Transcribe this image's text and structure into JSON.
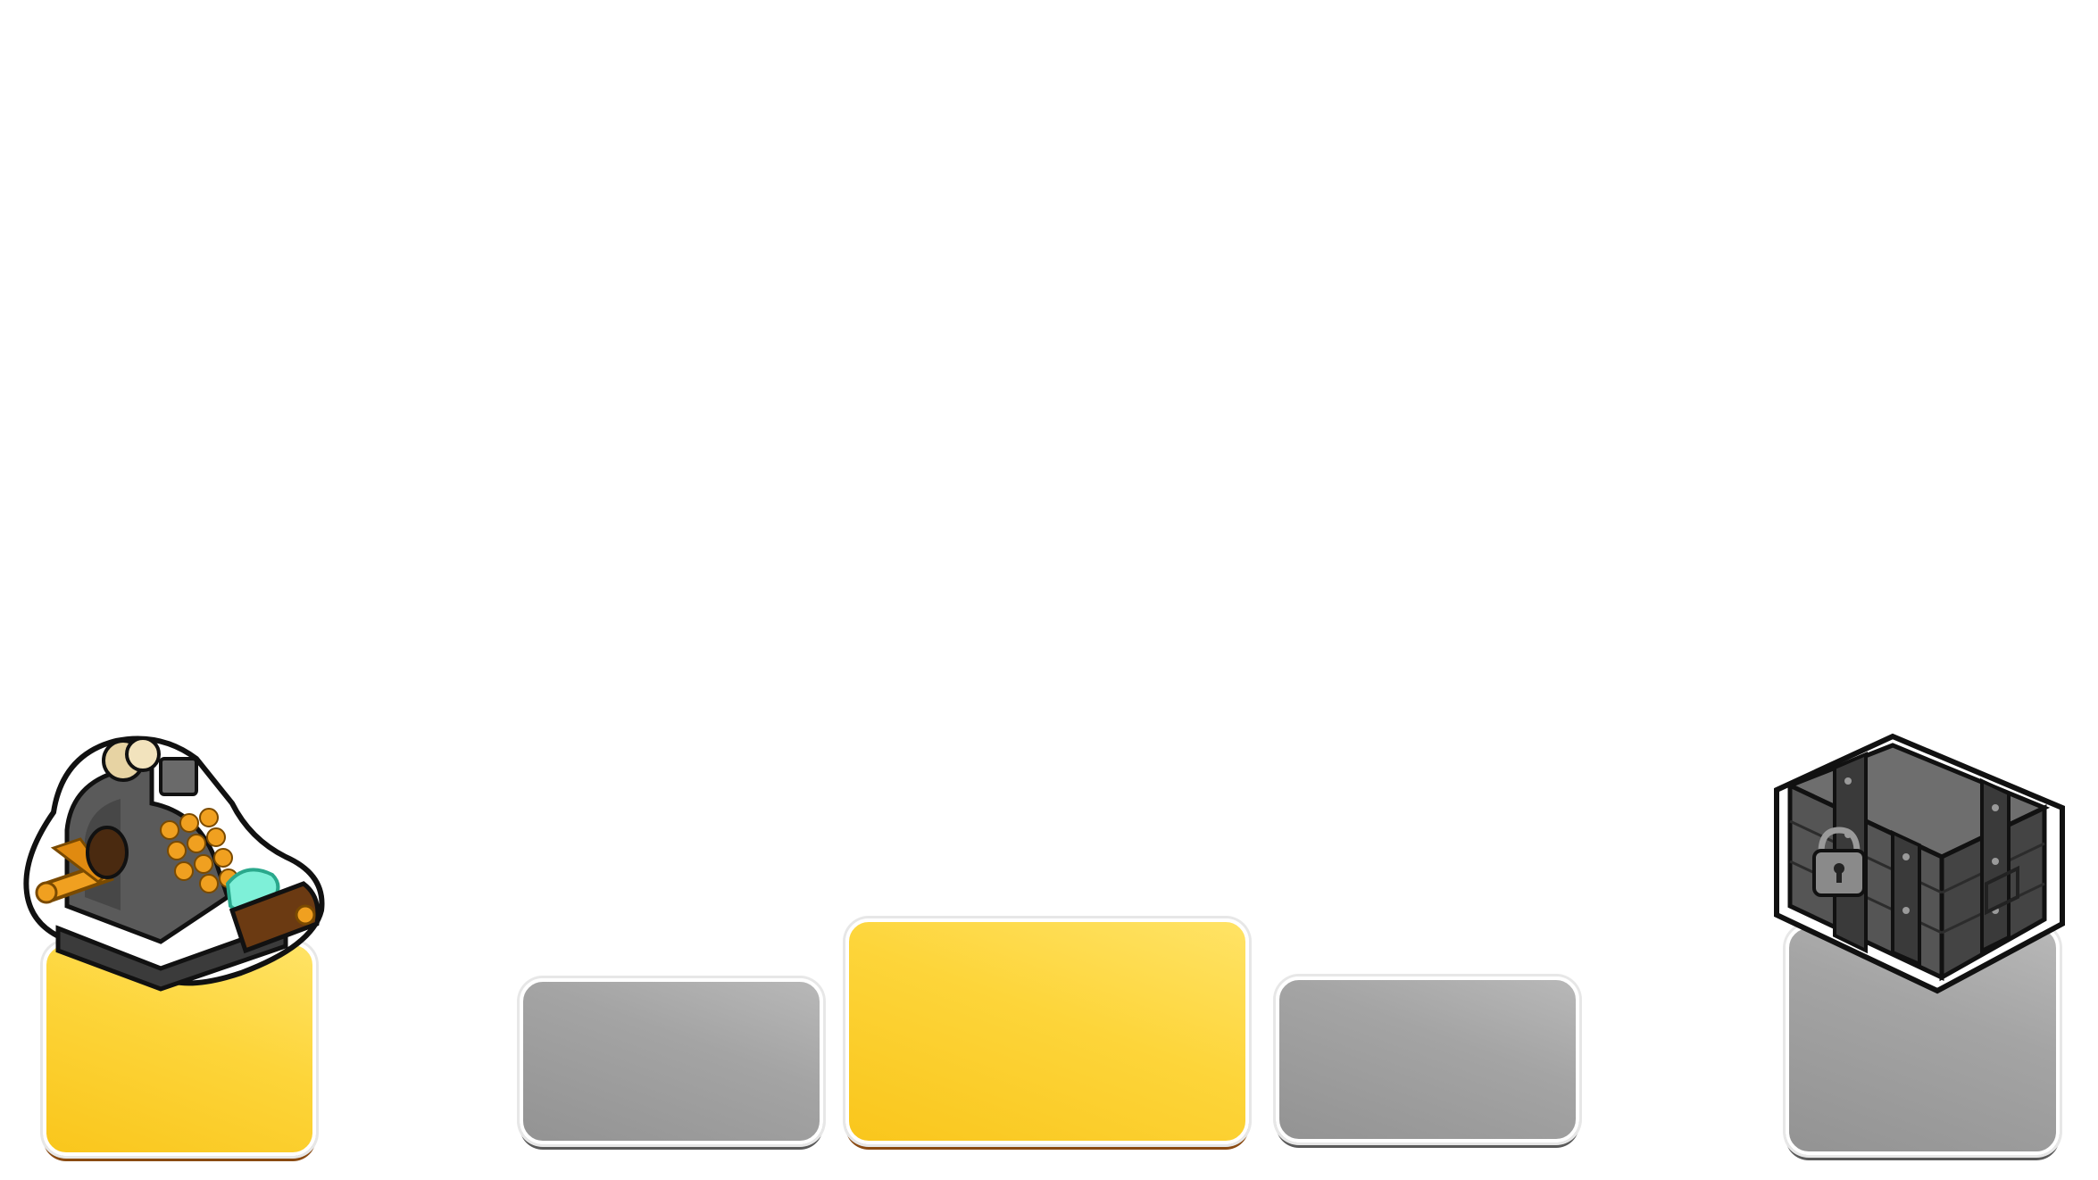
{
  "colors": {
    "active_panel": "#fdd53a",
    "inactive_panel": "#a4a4a4",
    "background": "#ffffff"
  },
  "bottom_bar": {
    "left_button": {
      "icon": "cash-register-icon",
      "state": "active",
      "label": ""
    },
    "mid_left_button": {
      "state": "inactive",
      "label": ""
    },
    "center_button": {
      "state": "active",
      "label": ""
    },
    "mid_right_button": {
      "state": "inactive",
      "label": ""
    },
    "right_button": {
      "icon": "locked-chest-icon",
      "state": "inactive",
      "label": ""
    }
  }
}
